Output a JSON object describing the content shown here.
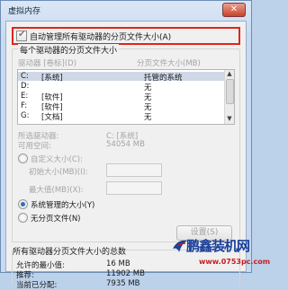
{
  "window": {
    "title": "虚拟内存",
    "close_label": "✕"
  },
  "auto_manage": {
    "label": "自动管理所有驱动器的分页文件大小(A)",
    "checked": true
  },
  "drives_group": {
    "legend": "每个驱动器的分页文件大小",
    "col_drive": "驱动器 [卷标](D)",
    "col_size": "分页文件大小(MB)",
    "rows": [
      {
        "drive": "C:",
        "label": "[系统]",
        "size": "托管的系统",
        "selected": true
      },
      {
        "drive": "D:",
        "label": "",
        "size": "无",
        "selected": false
      },
      {
        "drive": "E:",
        "label": "[软件]",
        "size": "无",
        "selected": false
      },
      {
        "drive": "F:",
        "label": "[软件]",
        "size": "无",
        "selected": false
      },
      {
        "drive": "G:",
        "label": "[文档]",
        "size": "无",
        "selected": false
      }
    ],
    "selected_drive_label": "所选驱动器:",
    "selected_drive_value": "C:  [系统]",
    "free_space_label": "可用空间:",
    "free_space_value": "54054 MB",
    "custom_size_label": "自定义大小(C):",
    "initial_size_label": "初始大小(MB)(I):",
    "max_size_label": "最大值(MB)(X):",
    "system_managed_label": "系统管理的大小(Y)",
    "no_paging_label": "无分页文件(N)",
    "set_button": "设置(S)"
  },
  "totals_group": {
    "legend": "所有驱动器分页文件大小的总数",
    "min_label": "允许的最小值:",
    "min_value": "16 MB",
    "recommended_label": "推荐:",
    "recommended_value": "11902 MB",
    "current_label": "当前已分配:",
    "current_value": "7935 MB"
  },
  "watermark": {
    "text": "鹏鑫装机网",
    "url": "www.0753pc.com"
  },
  "colors": {
    "highlight_border": "#e0251b",
    "radio_selected": "#2f6fbf",
    "watermark_blue": "#1a3f9a",
    "watermark_red": "#c81e1e"
  }
}
